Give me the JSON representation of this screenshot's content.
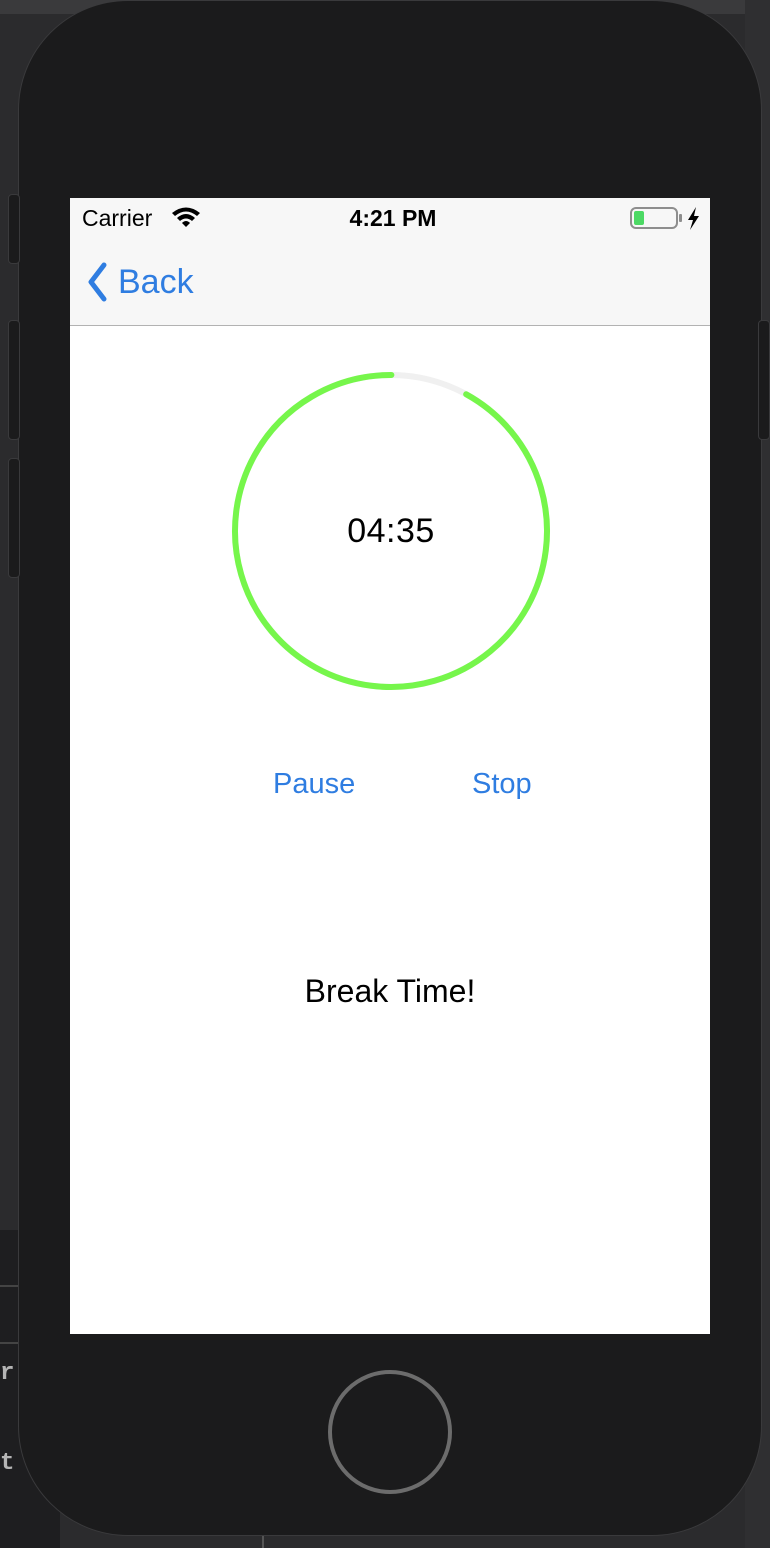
{
  "status_bar": {
    "carrier": "Carrier",
    "time": "4:21 PM",
    "battery_level": 0.25,
    "battery_color": "#4cd964"
  },
  "nav": {
    "back_label": "Back",
    "back_icon": "chevron-left-icon",
    "accent": "#2f7de1"
  },
  "timer": {
    "display": "04:35",
    "progress": 0.92,
    "ring_color": "#76f64b",
    "track_color": "#f0f0f0"
  },
  "controls": {
    "pause_label": "Pause",
    "stop_label": "Stop"
  },
  "message": "Break Time!",
  "background_glyphs": {
    "line1": "r",
    "line2": "t"
  }
}
